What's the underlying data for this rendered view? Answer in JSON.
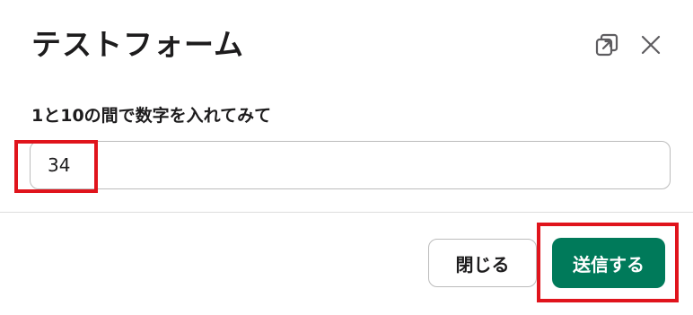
{
  "modal": {
    "title": "テストフォーム"
  },
  "form": {
    "label": "1と10の間で数字を入れてみて",
    "input_value": "34"
  },
  "footer": {
    "close_label": "閉じる",
    "submit_label": "送信する"
  },
  "colors": {
    "submit_bg": "#007a5a",
    "highlight_border": "#e0141c"
  },
  "icons": {
    "expand": "expand-window-icon",
    "close": "close-icon"
  }
}
